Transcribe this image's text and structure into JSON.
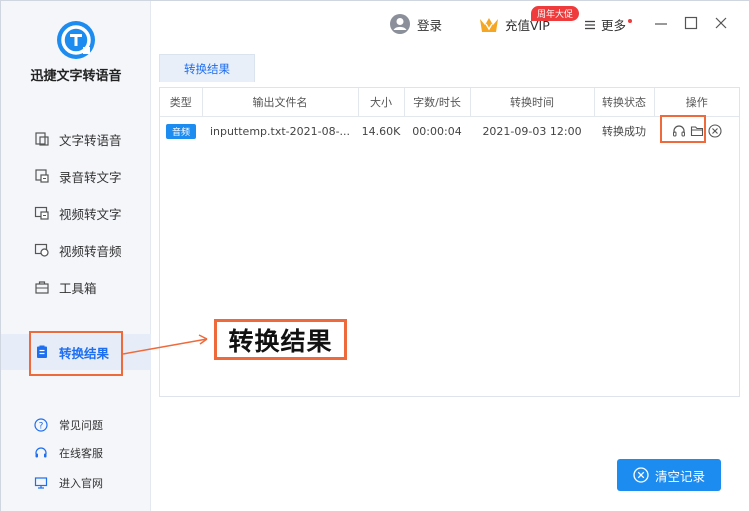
{
  "app": {
    "name": "迅捷文字转语音"
  },
  "sidebar": {
    "items": [
      {
        "label": "文字转语音",
        "icon": "text-to-speech-icon"
      },
      {
        "label": "录音转文字",
        "icon": "recording-to-text-icon"
      },
      {
        "label": "视频转文字",
        "icon": "video-to-text-icon"
      },
      {
        "label": "视频转音频",
        "icon": "video-to-audio-icon"
      },
      {
        "label": "工具箱",
        "icon": "toolbox-icon"
      },
      {
        "label": "转换结果",
        "icon": "conversion-result-icon",
        "active": true
      }
    ],
    "bottom_links": [
      {
        "label": "常见问题",
        "icon": "help-icon"
      },
      {
        "label": "在线客服",
        "icon": "headset-icon"
      },
      {
        "label": "进入官网",
        "icon": "monitor-icon"
      }
    ]
  },
  "header": {
    "login_label": "登录",
    "vip_label": "充值VIP",
    "promo_badge": "周年大促",
    "more_label": "更多"
  },
  "tab": {
    "label": "转换结果"
  },
  "table": {
    "columns": [
      "类型",
      "输出文件名",
      "大小",
      "字数/时长",
      "转换时间",
      "转换状态",
      "操作"
    ],
    "rows": [
      {
        "type": "音频",
        "filename": "inputtemp.txt-2021-08-...",
        "size": "14.60K",
        "duration": "00:00:04",
        "time": "2021-09-03 12:00",
        "status": "转换成功"
      }
    ]
  },
  "callout": {
    "label": "转换结果"
  },
  "clear_button": {
    "label": "清空记录"
  },
  "colors": {
    "accent": "#1d8cf0",
    "highlight": "#ef6a3b",
    "promo": "#ef3b3b"
  }
}
